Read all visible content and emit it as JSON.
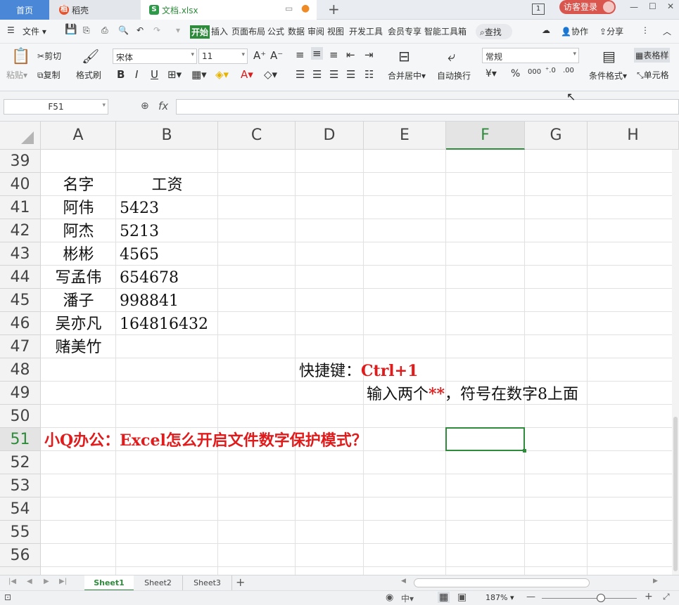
{
  "titlebar": {
    "home_tab": "首页",
    "daoke_tab": "稻壳",
    "doc_tab": "文档.xlsx",
    "login": "访客登录",
    "window_badge": "1"
  },
  "menubar": {
    "file": "文件",
    "tabs": [
      "开始",
      "插入",
      "页面布局",
      "公式",
      "数据",
      "审阅",
      "视图",
      "开发工具",
      "会员专享",
      "智能工具箱"
    ],
    "search": "查找",
    "collab": "协作",
    "share": "分享"
  },
  "ribbon": {
    "paste": "粘贴",
    "cut": "剪切",
    "copy": "复制",
    "format_painter": "格式刷",
    "font_name": "宋体",
    "font_size": "11",
    "merge_center": "合并居中",
    "wrap_text": "自动换行",
    "number_format": "常规",
    "cond_format": "条件格式",
    "table_style": "表格样",
    "cell_style": "单元格"
  },
  "formula_bar": {
    "name_box": "F51",
    "fx": "fx",
    "content": ""
  },
  "grid": {
    "columns": [
      "A",
      "B",
      "C",
      "D",
      "E",
      "F",
      "G",
      "H"
    ],
    "rows": [
      "39",
      "40",
      "41",
      "42",
      "43",
      "44",
      "45",
      "46",
      "47",
      "48",
      "49",
      "50",
      "51",
      "52",
      "53",
      "54",
      "55",
      "56"
    ],
    "active_cell": "F51",
    "cells": {
      "a40": "名字",
      "b40": "工资",
      "a41": "阿伟",
      "b41": "5423",
      "a42": "阿杰",
      "b42": "5213",
      "a43": "彬彬",
      "b43": "4565",
      "a44": "写孟伟",
      "b44": "654678",
      "a45": "潘子",
      "b45": "998841",
      "a46": "吴亦凡",
      "b46": "164816432",
      "a47": "赌美竹",
      "d48_label": "快捷键：",
      "d48_key": "Ctrl+1",
      "e49_pre": "输入两个",
      "e49_stars": "**",
      "e49_post": "，符号在数字8上面",
      "a51": "小Q办公：Excel怎么开启文件数字保护模式？"
    }
  },
  "sheets": [
    "Sheet1",
    "Sheet2",
    "Sheet3"
  ],
  "status": {
    "zoom": "187%"
  },
  "colors": {
    "accent": "#2e8b3b",
    "red_text": "#e11b1b",
    "home_tab": "#4a87d6",
    "login_btn": "#d9564f"
  }
}
